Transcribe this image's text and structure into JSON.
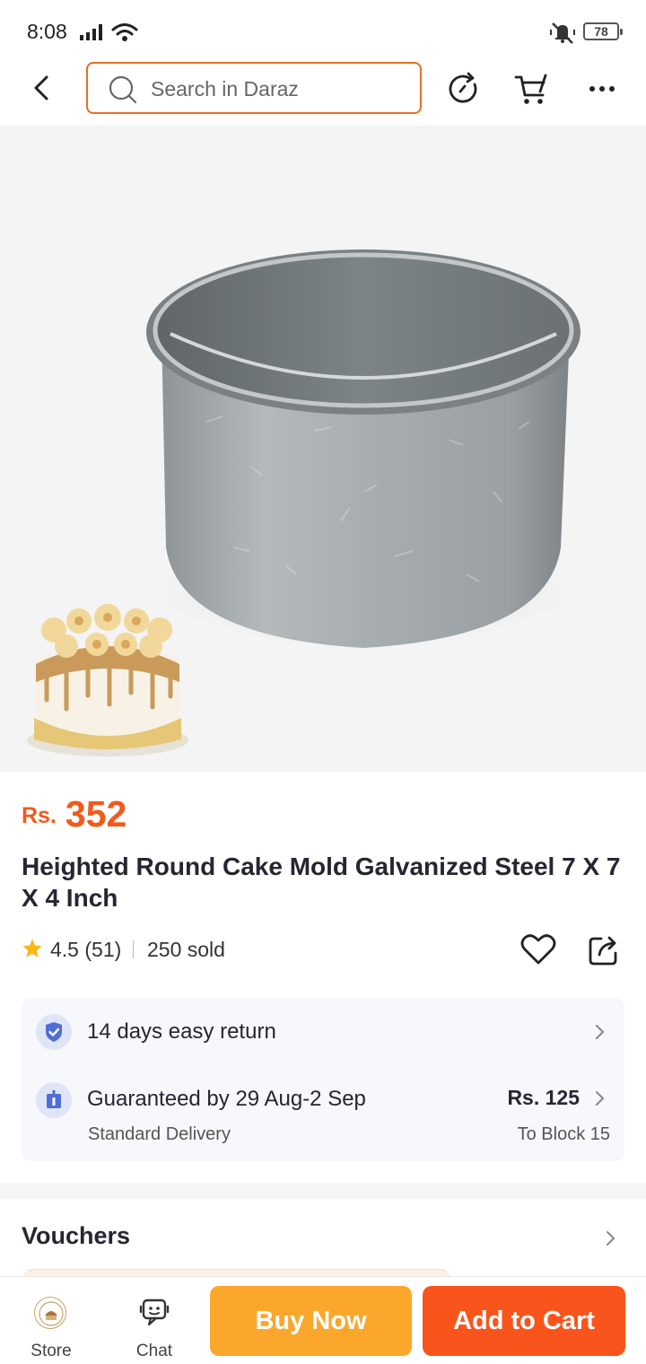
{
  "status_bar": {
    "time": "8:08",
    "battery": "78",
    "icons": [
      "signal-icon",
      "wifi-icon",
      "mute-icon",
      "battery-icon"
    ]
  },
  "header": {
    "search_placeholder": "Search in Daraz",
    "icons": [
      "back-icon",
      "search-icon",
      "refresh-icon",
      "cart-icon",
      "more-icon"
    ]
  },
  "product": {
    "currency": "Rs.",
    "price": "352",
    "title": "Heighted Round Cake Mold Galvanized Steel 7 X 7 X 4 Inch",
    "rating": "4.5 (51)",
    "sold": "250 sold"
  },
  "services": {
    "return_text": "14 days easy return",
    "delivery_title": "Guaranteed by 29 Aug-2 Sep",
    "delivery_type": "Standard Delivery",
    "delivery_fee": "Rs. 125",
    "delivery_location": "To Block 15"
  },
  "vouchers": {
    "label": "Vouchers"
  },
  "bottom_bar": {
    "store_label": "Store",
    "chat_label": "Chat",
    "buy_now_label": "Buy Now",
    "add_to_cart_label": "Add to Cart"
  },
  "colors": {
    "accent_orange": "#f05a1a",
    "buy_now_bg": "#fba72b",
    "add_to_cart_bg": "#f9541c",
    "search_border": "#e96d26",
    "badge_blue": "#4f6fd6"
  }
}
